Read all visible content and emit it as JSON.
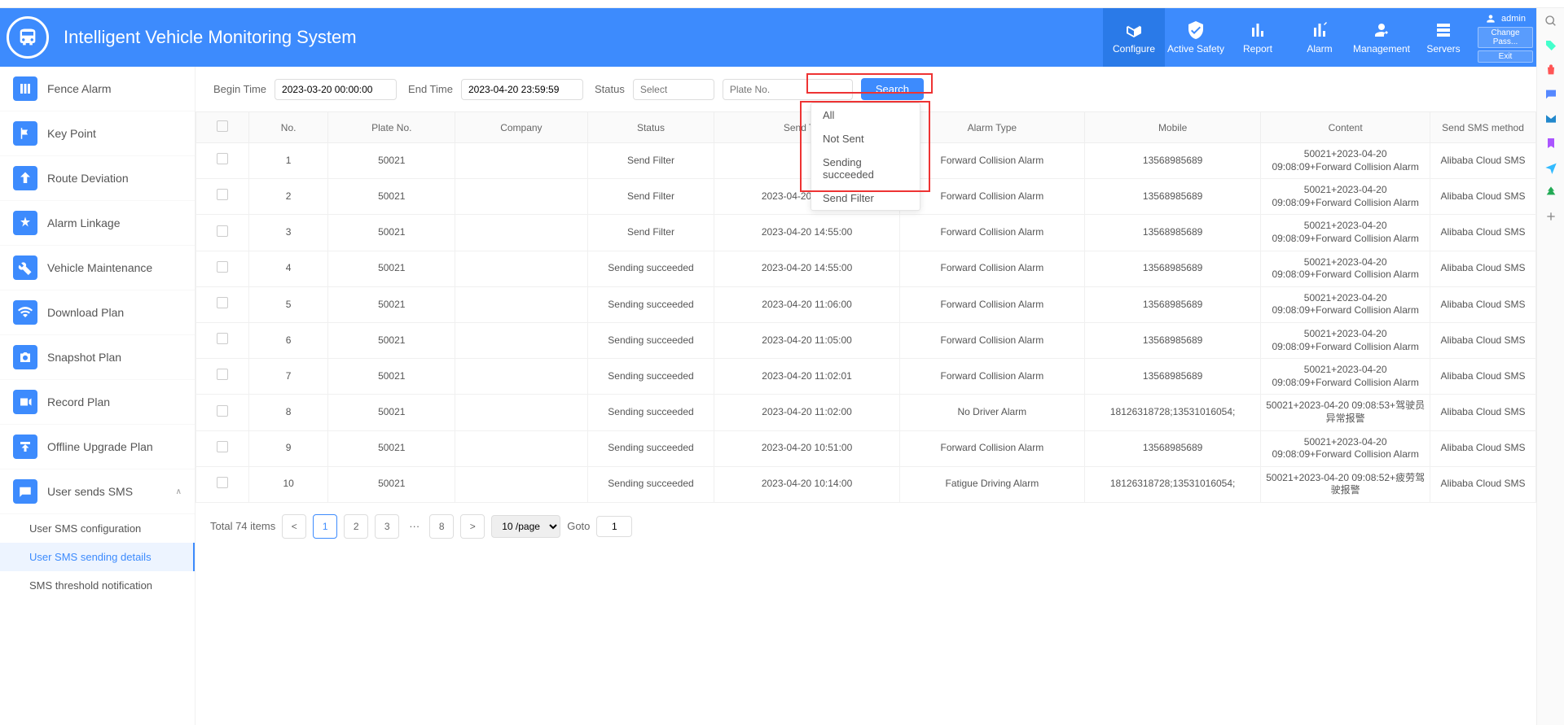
{
  "header": {
    "title": "Intelligent Vehicle Monitoring System",
    "nav": [
      {
        "label": "Configure"
      },
      {
        "label": "Active Safety"
      },
      {
        "label": "Report"
      },
      {
        "label": "Alarm"
      },
      {
        "label": "Management"
      },
      {
        "label": "Servers"
      }
    ],
    "user": {
      "name": "admin",
      "changePass": "Change Pass...",
      "exit": "Exit"
    }
  },
  "sidebar": {
    "items": [
      {
        "label": "Fence Alarm"
      },
      {
        "label": "Key Point"
      },
      {
        "label": "Route Deviation"
      },
      {
        "label": "Alarm Linkage"
      },
      {
        "label": "Vehicle Maintenance"
      },
      {
        "label": "Download Plan"
      },
      {
        "label": "Snapshot Plan"
      },
      {
        "label": "Record Plan"
      },
      {
        "label": "Offline Upgrade Plan"
      },
      {
        "label": "User sends SMS"
      }
    ],
    "subs": [
      {
        "label": "User SMS configuration"
      },
      {
        "label": "User SMS sending details"
      },
      {
        "label": "SMS threshold notification"
      }
    ]
  },
  "filters": {
    "beginTimeLabel": "Begin Time",
    "beginTimeValue": "2023-03-20 00:00:00",
    "endTimeLabel": "End Time",
    "endTimeValue": "2023-04-20 23:59:59",
    "statusLabel": "Status",
    "statusPlaceholder": "Select",
    "platePlaceholder": "Plate No.",
    "searchBtn": "Search"
  },
  "dropdown": {
    "options": [
      "All",
      "Not Sent",
      "Sending succeeded",
      "Send Filter"
    ]
  },
  "table": {
    "headers": {
      "no": "No.",
      "plate": "Plate No.",
      "company": "Company",
      "status": "Status",
      "sendTime": "Send Time",
      "alarmType": "Alarm Type",
      "mobile": "Mobile",
      "content": "Content",
      "method": "Send SMS method"
    },
    "rows": [
      {
        "no": "1",
        "plate": "50021",
        "company": "",
        "status": "Send Filter",
        "time": "",
        "alarm": "Forward Collision Alarm",
        "mobile": "13568985689",
        "content": "50021+2023-04-20 09:08:09+Forward Collision Alarm",
        "method": "Alibaba Cloud SMS"
      },
      {
        "no": "2",
        "plate": "50021",
        "company": "",
        "status": "Send Filter",
        "time": "2023-04-20 14:55:00",
        "alarm": "Forward Collision Alarm",
        "mobile": "13568985689",
        "content": "50021+2023-04-20 09:08:09+Forward Collision Alarm",
        "method": "Alibaba Cloud SMS"
      },
      {
        "no": "3",
        "plate": "50021",
        "company": "",
        "status": "Send Filter",
        "time": "2023-04-20 14:55:00",
        "alarm": "Forward Collision Alarm",
        "mobile": "13568985689",
        "content": "50021+2023-04-20 09:08:09+Forward Collision Alarm",
        "method": "Alibaba Cloud SMS"
      },
      {
        "no": "4",
        "plate": "50021",
        "company": "",
        "status": "Sending succeeded",
        "time": "2023-04-20 14:55:00",
        "alarm": "Forward Collision Alarm",
        "mobile": "13568985689",
        "content": "50021+2023-04-20 09:08:09+Forward Collision Alarm",
        "method": "Alibaba Cloud SMS"
      },
      {
        "no": "5",
        "plate": "50021",
        "company": "",
        "status": "Sending succeeded",
        "time": "2023-04-20 11:06:00",
        "alarm": "Forward Collision Alarm",
        "mobile": "13568985689",
        "content": "50021+2023-04-20 09:08:09+Forward Collision Alarm",
        "method": "Alibaba Cloud SMS"
      },
      {
        "no": "6",
        "plate": "50021",
        "company": "",
        "status": "Sending succeeded",
        "time": "2023-04-20 11:05:00",
        "alarm": "Forward Collision Alarm",
        "mobile": "13568985689",
        "content": "50021+2023-04-20 09:08:09+Forward Collision Alarm",
        "method": "Alibaba Cloud SMS"
      },
      {
        "no": "7",
        "plate": "50021",
        "company": "",
        "status": "Sending succeeded",
        "time": "2023-04-20 11:02:01",
        "alarm": "Forward Collision Alarm",
        "mobile": "13568985689",
        "content": "50021+2023-04-20 09:08:09+Forward Collision Alarm",
        "method": "Alibaba Cloud SMS"
      },
      {
        "no": "8",
        "plate": "50021",
        "company": "",
        "status": "Sending succeeded",
        "time": "2023-04-20 11:02:00",
        "alarm": "No Driver Alarm",
        "mobile": "18126318728;13531016054;",
        "content": "50021+2023-04-20 09:08:53+驾驶员异常报警",
        "method": "Alibaba Cloud SMS"
      },
      {
        "no": "9",
        "plate": "50021",
        "company": "",
        "status": "Sending succeeded",
        "time": "2023-04-20 10:51:00",
        "alarm": "Forward Collision Alarm",
        "mobile": "13568985689",
        "content": "50021+2023-04-20 09:08:09+Forward Collision Alarm",
        "method": "Alibaba Cloud SMS"
      },
      {
        "no": "10",
        "plate": "50021",
        "company": "",
        "status": "Sending succeeded",
        "time": "2023-04-20 10:14:00",
        "alarm": "Fatigue Driving Alarm",
        "mobile": "18126318728;13531016054;",
        "content": "50021+2023-04-20 09:08:52+疲劳驾驶报警",
        "method": "Alibaba Cloud SMS"
      }
    ]
  },
  "pagination": {
    "total": "Total 74 items",
    "pages": [
      "1",
      "2",
      "3"
    ],
    "lastPage": "8",
    "perPage": "10 /page",
    "gotoLabel": "Goto",
    "gotoValue": "1"
  }
}
